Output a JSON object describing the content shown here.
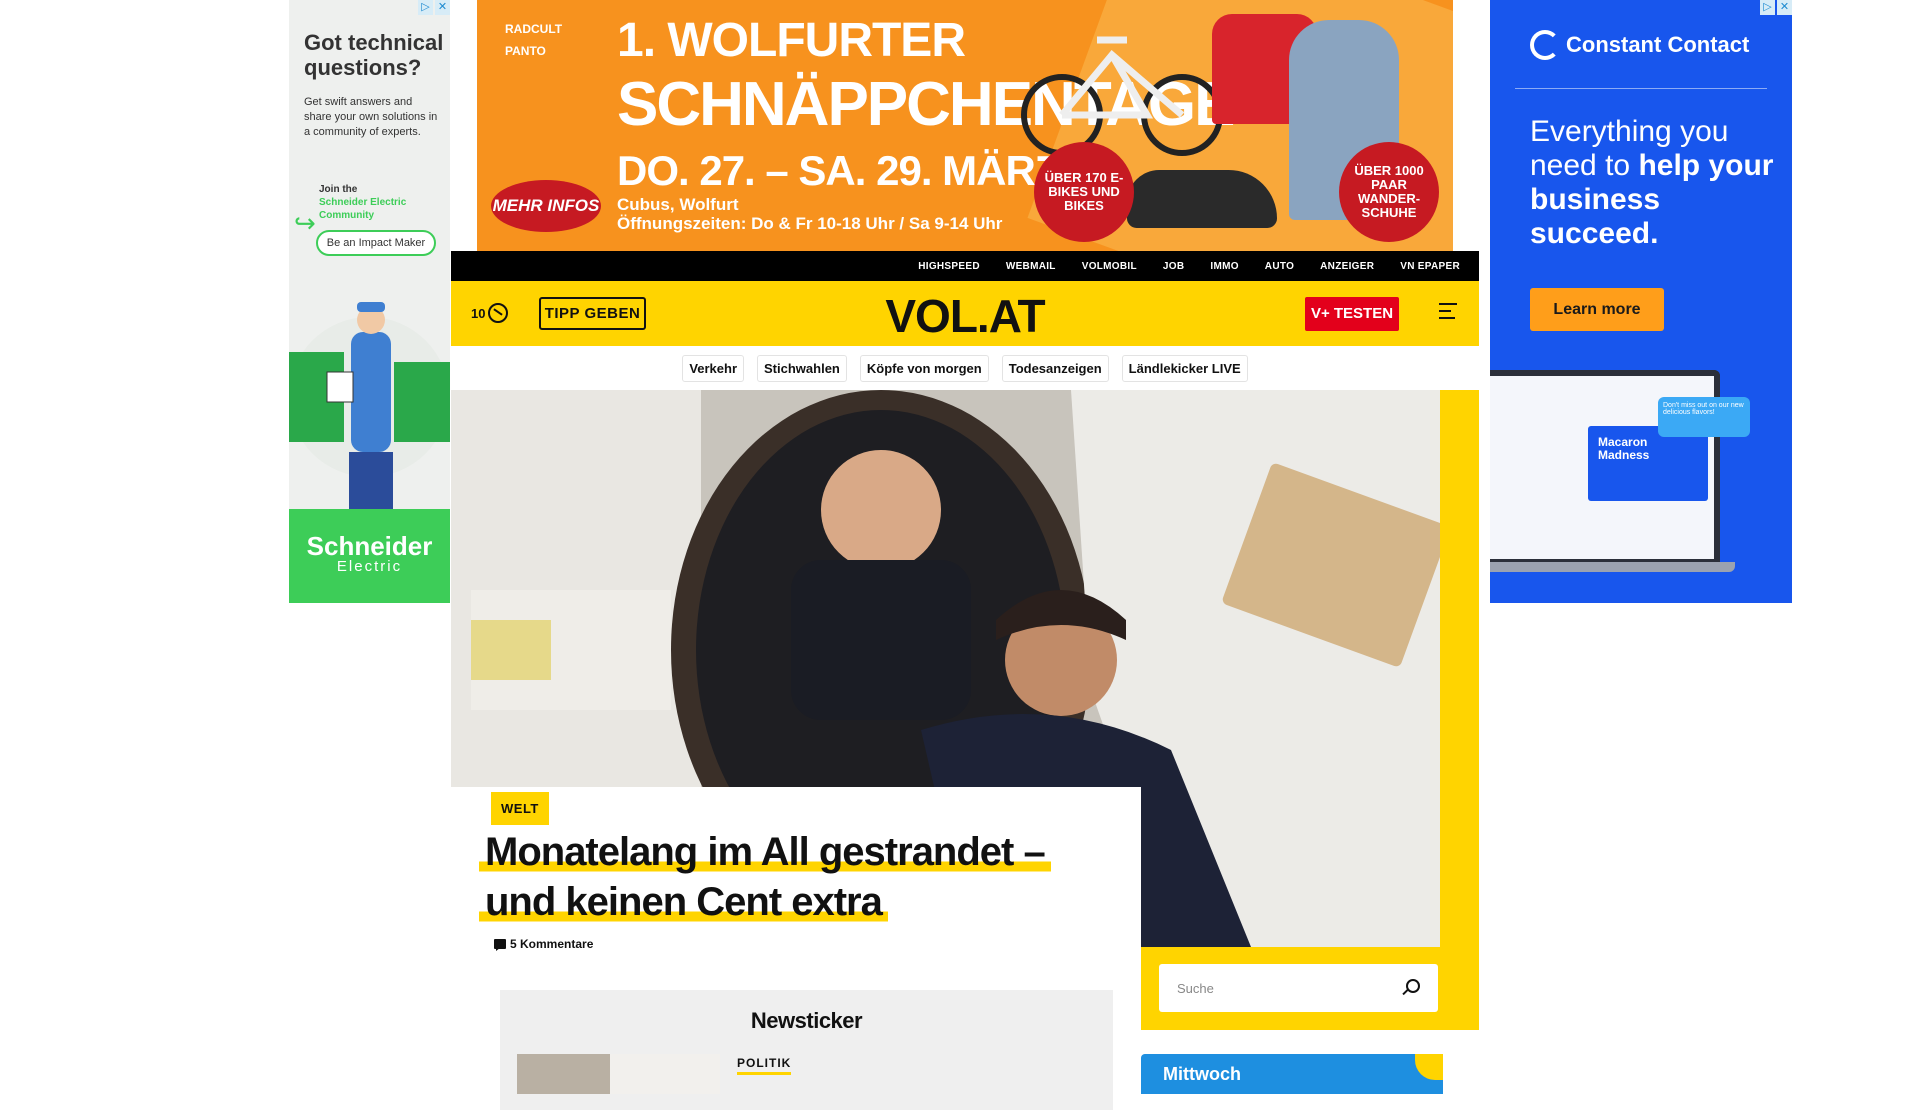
{
  "ads": {
    "left": {
      "question": "Got technical questions?",
      "description": "Get swift answers and share your own solutions in a community of experts.",
      "join_line": "Join the",
      "community": "Schneider Electric Community",
      "cta": "Be an Impact Maker",
      "brand_main": "Schneider",
      "brand_sub": "Electric"
    },
    "banner": {
      "brand1": "RADCULT",
      "brand2": "PANTO",
      "title_line1": "1. WOLFURTER",
      "title_line2": "SCHNÄPPCHENTAGE",
      "dates": "DO. 27. – SA. 29. MÄRZ",
      "location": "Cubus, Wolfurt",
      "hours": "Öffnungszeiten: Do & Fr 10-18 Uhr / Sa 9-14 Uhr",
      "cta": "MEHR INFOS",
      "badge1": "ÜBER 170 E-BIKES UND BIKES",
      "badge2": "ÜBER 1000 PAAR WANDER-SCHUHE"
    },
    "right": {
      "logo": "Constant Contact",
      "headline_plain": "Everything you need to ",
      "headline_bold": "help your business succeed.",
      "cta": "Learn more",
      "card_title": "Macaron Madness",
      "bubble": "Don't miss out on our new delicious flavors!"
    }
  },
  "topnav": [
    "HIGHSPEED",
    "WEBMAIL",
    "VOLMOBIL",
    "JOB",
    "IMMO",
    "AUTO",
    "ANZEIGER",
    "VN EPAPER"
  ],
  "header": {
    "weather_count": "10",
    "tipp_label": "TIPP GEBEN",
    "logo": "VOL.AT",
    "vplus_label": "V+ TESTEN"
  },
  "subnav": [
    "Verkehr",
    "Stichwahlen",
    "Köpfe von morgen",
    "Todesanzeigen",
    "Ländlekicker LIVE"
  ],
  "article": {
    "category": "WELT",
    "headline": "Monatelang im All gestrandet – und keinen Cent extra",
    "comments": "5 Kommentare"
  },
  "search": {
    "placeholder": "Suche"
  },
  "newsticker": {
    "title": "Newsticker",
    "first_category": "POLITIK"
  },
  "weather_widget": {
    "day": "Mittwoch"
  },
  "colors": {
    "brand_yellow": "#ffd400",
    "vplus_red": "#e3001b",
    "schneider_green": "#3dcd58",
    "cc_blue": "#1856ed",
    "banner_orange": "#f7921e"
  }
}
